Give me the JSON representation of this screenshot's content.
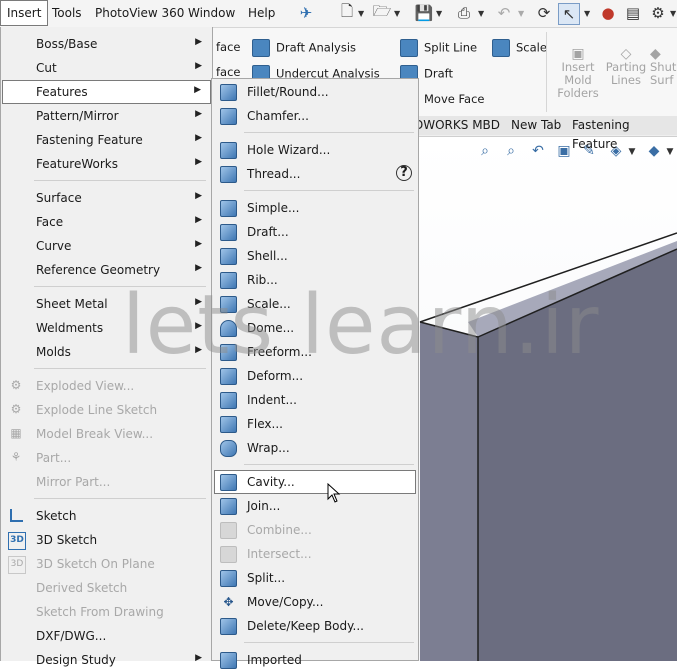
{
  "menubar": {
    "items": [
      "Insert",
      "Tools",
      "PhotoView 360",
      "Window",
      "Help"
    ],
    "active": "Insert"
  },
  "ribbon": {
    "face_partial_1": "face",
    "face_partial_2": "face",
    "draft_analysis": "Draft Analysis",
    "undercut_analysis": "Undercut Analysis",
    "split_line": "Split Line",
    "scale": "Scale",
    "draft": "Draft",
    "move_face": "Move Face",
    "insert_mold_folders": "Insert Mold Folders",
    "parting_lines": "Parting Lines",
    "shut_surfaces_partial": "Shut Surf"
  },
  "tabs": [
    "DWORKS MBD",
    "New Tab",
    "Fastening Feature"
  ],
  "insert_menu": {
    "items": [
      {
        "label": "Boss/Base",
        "submenu": true,
        "enabled": true
      },
      {
        "label": "Cut",
        "submenu": true,
        "enabled": true
      },
      {
        "label": "Features",
        "submenu": true,
        "enabled": true,
        "highlighted": true
      },
      {
        "label": "Pattern/Mirror",
        "submenu": true,
        "enabled": true
      },
      {
        "label": "Fastening Feature",
        "submenu": true,
        "enabled": true
      },
      {
        "label": "FeatureWorks",
        "submenu": true,
        "enabled": true
      },
      {
        "label": "Surface",
        "submenu": true,
        "enabled": true
      },
      {
        "label": "Face",
        "submenu": true,
        "enabled": true
      },
      {
        "label": "Curve",
        "submenu": true,
        "enabled": true
      },
      {
        "label": "Reference Geometry",
        "submenu": true,
        "enabled": true
      },
      {
        "label": "Sheet Metal",
        "submenu": true,
        "enabled": true
      },
      {
        "label": "Weldments",
        "submenu": true,
        "enabled": true
      },
      {
        "label": "Molds",
        "submenu": true,
        "enabled": true
      },
      {
        "label": "Exploded View...",
        "submenu": false,
        "enabled": false
      },
      {
        "label": "Explode Line Sketch",
        "submenu": false,
        "enabled": false
      },
      {
        "label": "Model Break View...",
        "submenu": false,
        "enabled": false
      },
      {
        "label": "Part...",
        "submenu": false,
        "enabled": false
      },
      {
        "label": "Mirror Part...",
        "submenu": false,
        "enabled": false
      },
      {
        "label": "Sketch",
        "submenu": false,
        "enabled": true
      },
      {
        "label": "3D Sketch",
        "submenu": false,
        "enabled": true
      },
      {
        "label": "3D Sketch On Plane",
        "submenu": false,
        "enabled": false
      },
      {
        "label": "Derived Sketch",
        "submenu": false,
        "enabled": false
      },
      {
        "label": "Sketch From Drawing",
        "submenu": false,
        "enabled": false
      },
      {
        "label": "DXF/DWG...",
        "submenu": false,
        "enabled": true
      },
      {
        "label": "Design Study",
        "submenu": true,
        "enabled": true
      }
    ]
  },
  "features_menu": {
    "items": [
      {
        "label": "Fillet/Round...",
        "enabled": true
      },
      {
        "label": "Chamfer...",
        "enabled": true
      },
      {
        "label": "Hole Wizard...",
        "enabled": true
      },
      {
        "label": "Thread...",
        "enabled": true
      },
      {
        "label": "Simple...",
        "enabled": true
      },
      {
        "label": "Draft...",
        "enabled": true
      },
      {
        "label": "Shell...",
        "enabled": true
      },
      {
        "label": "Rib...",
        "enabled": true
      },
      {
        "label": "Scale...",
        "enabled": true
      },
      {
        "label": "Dome...",
        "enabled": true
      },
      {
        "label": "Freeform...",
        "enabled": true
      },
      {
        "label": "Deform...",
        "enabled": true
      },
      {
        "label": "Indent...",
        "enabled": true
      },
      {
        "label": "Flex...",
        "enabled": true
      },
      {
        "label": "Wrap...",
        "enabled": true
      },
      {
        "label": "Cavity...",
        "enabled": true,
        "highlighted": true
      },
      {
        "label": "Join...",
        "enabled": true
      },
      {
        "label": "Combine...",
        "enabled": false
      },
      {
        "label": "Intersect...",
        "enabled": false
      },
      {
        "label": "Split...",
        "enabled": true
      },
      {
        "label": "Move/Copy...",
        "enabled": true
      },
      {
        "label": "Delete/Keep Body...",
        "enabled": true
      },
      {
        "label": "Imported",
        "enabled": true
      }
    ]
  },
  "watermark": "lets learn.ir",
  "colors": {
    "menu_bg": "#f0f0f0",
    "highlight_border": "#7a7a7a",
    "disabled_text": "#a8a8a8",
    "model_face_right": "#6b6d80",
    "model_face_top": "#9fa1b2",
    "model_face_front": "#4b4d5e"
  }
}
